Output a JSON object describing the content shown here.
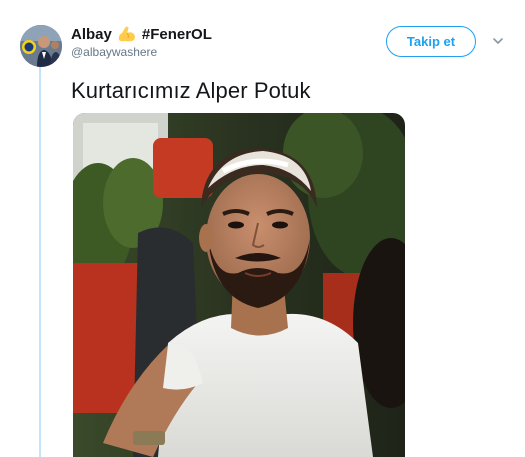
{
  "tweet": {
    "display_name": "Albay",
    "hashtag": "#FenerOL",
    "handle": "@albaywashere",
    "follow_label": "Takip et",
    "text": "Kurtarıcımız Alper Potuk"
  },
  "icons": {
    "emoji": "flexed-biceps-emoji",
    "menu": "chevron-down-icon"
  },
  "colors": {
    "accent": "#1da1f2",
    "thread_line": "#c4e4f7",
    "secondary_text": "#657786"
  }
}
